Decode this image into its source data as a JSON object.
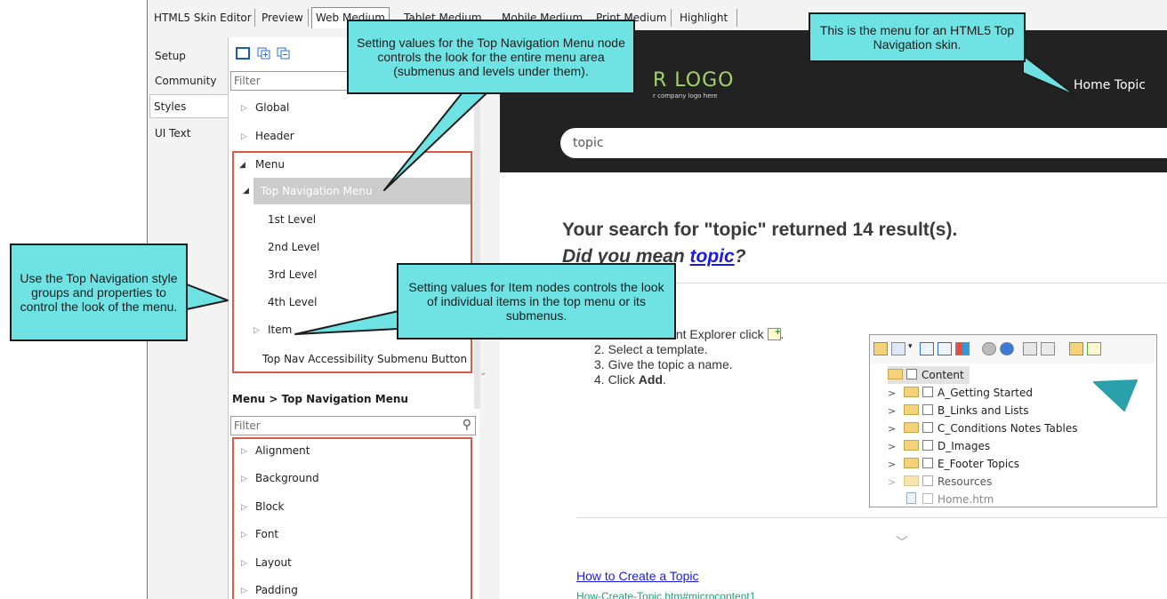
{
  "tabs": [
    {
      "label": "HTML5 Skin Editor",
      "active": false
    },
    {
      "label": "Preview",
      "active": false
    },
    {
      "label": "Web Medium",
      "active": true
    },
    {
      "label": "Tablet Medium",
      "active": false
    },
    {
      "label": "Mobile Medium",
      "active": false
    },
    {
      "label": "Print Medium",
      "active": false
    },
    {
      "label": "Highlight",
      "active": false
    }
  ],
  "vtabs": [
    {
      "label": "Setup"
    },
    {
      "label": "Community"
    },
    {
      "label": "Styles",
      "active": true
    },
    {
      "label": "UI Text"
    }
  ],
  "styles_panel": {
    "filter_placeholder": "Filter",
    "tree": [
      {
        "label": "Global",
        "expand": "collapsed"
      },
      {
        "label": "Header",
        "expand": "collapsed"
      },
      {
        "label": "Menu",
        "expand": "expanded"
      },
      {
        "label": "Top Navigation Menu",
        "expand": "expanded",
        "selected": true
      },
      {
        "label": "1st Level"
      },
      {
        "label": "2nd Level"
      },
      {
        "label": "3rd Level"
      },
      {
        "label": "4th Level"
      },
      {
        "label": "Item",
        "expand": "collapsed"
      },
      {
        "label": "Top Nav Accessibility Submenu Button"
      }
    ],
    "section_title": "Menu > Top Navigation Menu",
    "props_filter_placeholder": "Filter",
    "properties": [
      "Alignment",
      "Background",
      "Block",
      "Font",
      "Layout",
      "Padding"
    ]
  },
  "preview": {
    "logo": "R LOGO",
    "logo_sub": "r company logo here",
    "home_topic": "Home Topic",
    "search_value": "topic",
    "result_line1": "Your search for \"topic\" returned 14 result(s).",
    "result_line2_prefix": "Did you mean ",
    "result_line2_link": "topic",
    "result_line2_suffix": "?",
    "steps": {
      "s1": "1. In the Content Explorer click",
      "s2": "2. Select a template.",
      "s3": "3. Give the topic a name.",
      "s4_prefix": "4. Click ",
      "s4_bold": "Add",
      "s4_suffix": "."
    },
    "link_title": "How to Create a Topic",
    "link_url": "How-Create-Topic.htm#microcontent1"
  },
  "content_explorer": {
    "root": "Content",
    "items": [
      {
        "label": "A_Getting Started"
      },
      {
        "label": "B_Links and Lists"
      },
      {
        "label": "C_Conditions Notes Tables"
      },
      {
        "label": "D_Images"
      },
      {
        "label": "E_Footer Topics"
      },
      {
        "label": "Resources"
      }
    ],
    "file": "Home.htm"
  },
  "callouts": {
    "top_nav_menu": "Setting values for the Top Navigation Menu node controls the look for the entire menu area (submenus and levels under them).",
    "menu_for_skin": "This is the menu for an HTML5 Top Navigation skin.",
    "top_nav_groups": "Use the Top Navigation style groups and properties to control the look of the menu.",
    "item_nodes": "Setting values for Item nodes controls the look of individual items in the top menu or its submenus."
  },
  "colors": {
    "callout_fill": "#6fe3e3",
    "highlight_box": "#dc5a44",
    "preview_header": "#222222",
    "logo": "#a5d36a",
    "link": "#1a1ae6"
  }
}
